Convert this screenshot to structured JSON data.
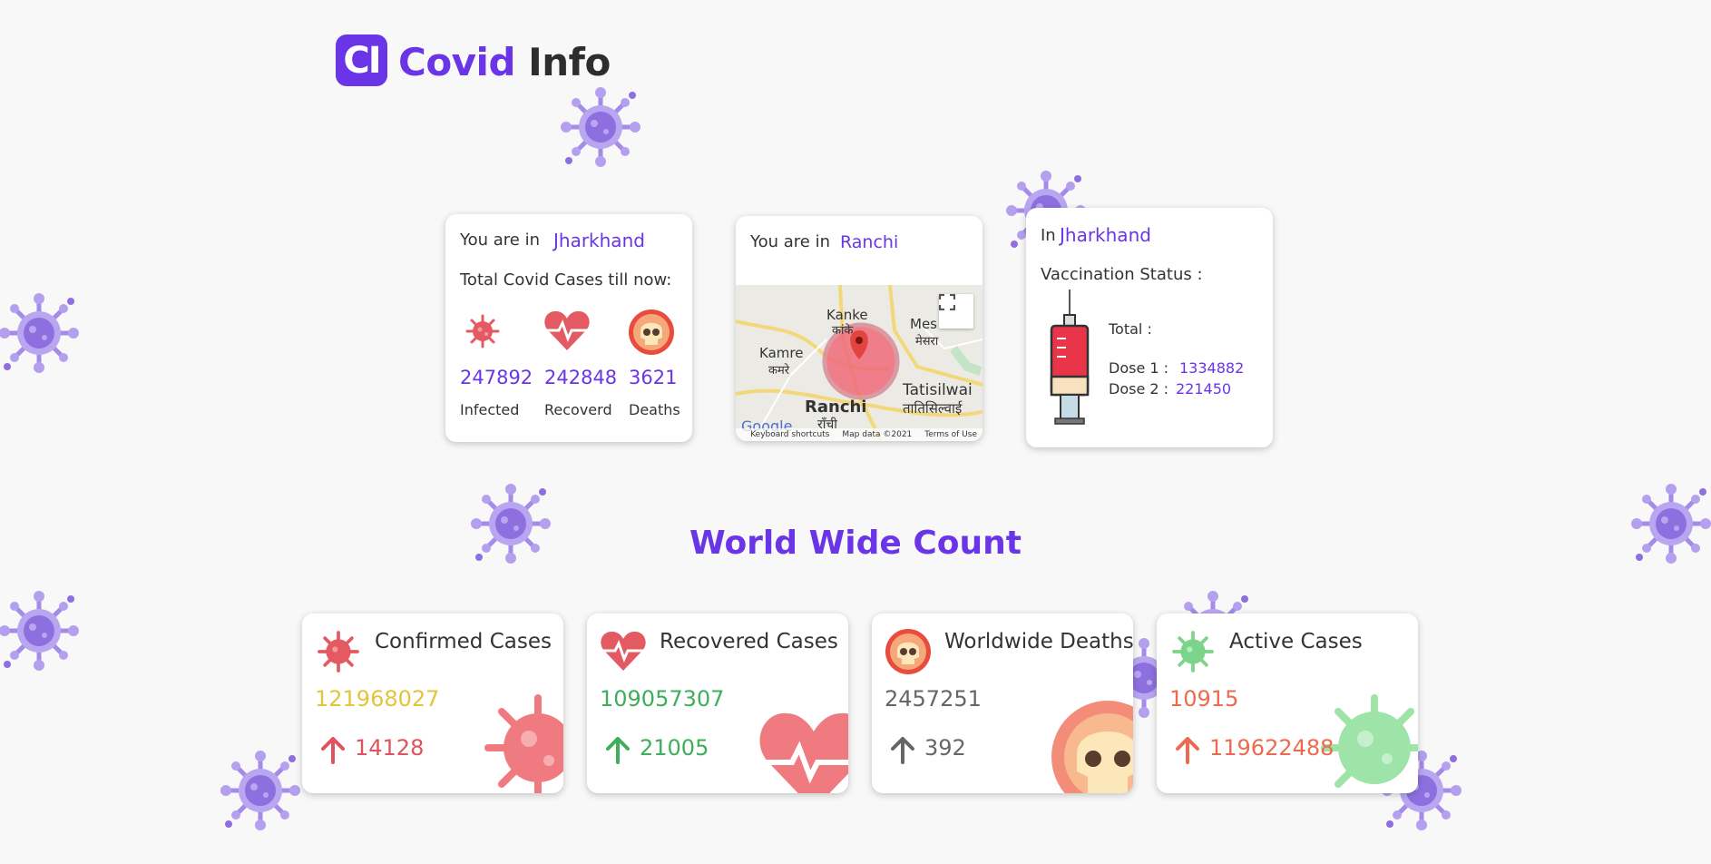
{
  "app": {
    "logo_initials": "CI",
    "title_part1": "Covid",
    "title_part2": "Info"
  },
  "state_card": {
    "prefix": "You are in",
    "state": "Jharkhand",
    "subtitle": "Total Covid Cases till now:",
    "stats": [
      {
        "icon": "virus-icon",
        "value": "247892",
        "label": "Infected"
      },
      {
        "icon": "heart-icon",
        "value": "242848",
        "label": "Recoverd"
      },
      {
        "icon": "skull-icon",
        "value": "3621",
        "label": "Deaths"
      }
    ]
  },
  "map_card": {
    "prefix": "You are in",
    "city": "Ranchi",
    "map_labels": {
      "kanke": "Kanke",
      "kanke_hi": "कांके",
      "kamre": "Kamre",
      "kamre_hi": "कमरे",
      "mes": "Mes",
      "mes_hi": "मेसरा",
      "ranchi": "Ranchi",
      "ranchi_hi": "राँची",
      "tatisilwai": "Tatisilwai",
      "tatisilwai_hi": "तातिसिल्वाई",
      "google": "Google"
    },
    "footer": {
      "shortcuts": "Keyboard shortcuts",
      "data": "Map data ©2021",
      "terms": "Terms of Use"
    }
  },
  "vaccine_card": {
    "prefix": "In",
    "state": "Jharkhand",
    "status_label": "Vaccination Status :",
    "total_label": "Total :",
    "dose1_label": "Dose 1 :",
    "dose1_value": "1334882",
    "dose2_label": "Dose 2 :",
    "dose2_value": "221450"
  },
  "world": {
    "title": "World Wide Count",
    "cards": [
      {
        "title": "Confirmed Cases",
        "value": "121968027",
        "increase": "14128",
        "value_color": "#e3c43a",
        "increase_color": "#e0525e",
        "arrow_color": "#e0525e"
      },
      {
        "title": "Recovered Cases",
        "value": "109057307",
        "increase": "21005",
        "value_color": "#3fae5a",
        "increase_color": "#3fae5a",
        "arrow_color": "#3fae5a"
      },
      {
        "title": "Worldwide Deaths",
        "value": "2457251",
        "increase": "392",
        "value_color": "#666666",
        "increase_color": "#666666",
        "arrow_color": "#666666"
      },
      {
        "title": "Active Cases",
        "value": "10915",
        "increase": "119622488",
        "value_color": "#ee6a4e",
        "increase_color": "#ee6a4e",
        "arrow_color": "#ee6a4e"
      }
    ]
  },
  "colors": {
    "brand": "#6a35e6",
    "virus_decor": "#9b80e6"
  }
}
